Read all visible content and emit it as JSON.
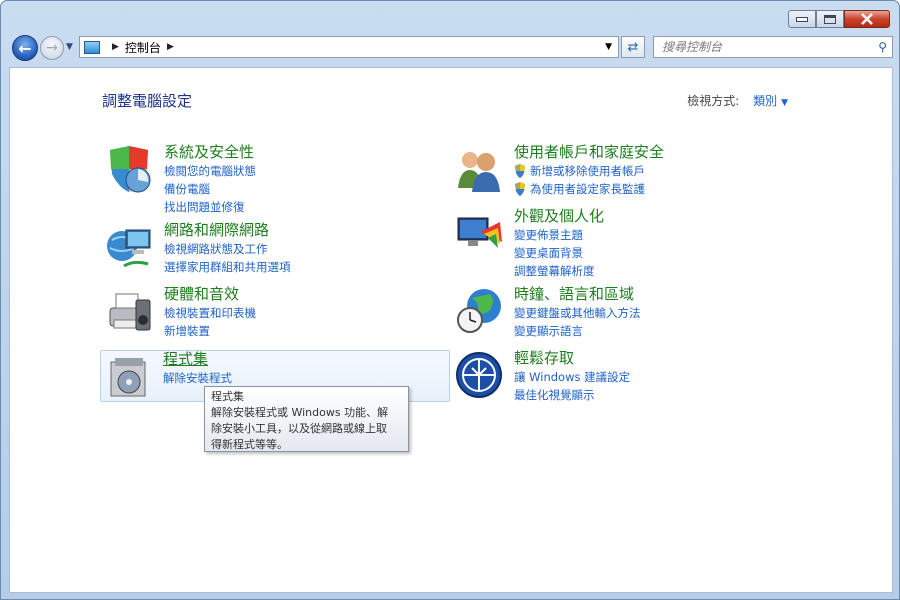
{
  "titlebar": {
    "minimize_icon": "minimize-icon",
    "maximize_icon": "maximize-icon",
    "close_icon": "close-icon"
  },
  "nav": {
    "back_icon": "back-arrow-icon",
    "forward_icon": "forward-arrow-icon",
    "address_path": "控制台",
    "search_placeholder": "搜尋控制台"
  },
  "header": {
    "title": "調整電腦設定",
    "view_by_label": "檢視方式:",
    "view_by_value": "類別"
  },
  "categories": [
    {
      "title": "系統及安全性",
      "links": [
        "檢閱您的電腦狀態",
        "備份電腦",
        "找出問題並修復"
      ]
    },
    {
      "title": "網路和網際網路",
      "links": [
        "檢視網路狀態及工作",
        "選擇家用群組和共用選項"
      ]
    },
    {
      "title": "硬體和音效",
      "links": [
        "檢視裝置和印表機",
        "新增裝置"
      ]
    },
    {
      "title": "程式集",
      "links": [
        "解除安裝程式"
      ]
    },
    {
      "title": "使用者帳戶和家庭安全",
      "links": [
        "新增或移除使用者帳戶",
        "為使用者設定家長監護"
      ]
    },
    {
      "title": "外觀及個人化",
      "links": [
        "變更佈景主題",
        "變更桌面背景",
        "調整螢幕解析度"
      ]
    },
    {
      "title": "時鐘、語言和區域",
      "links": [
        "變更鍵盤或其他輸入方法",
        "變更顯示語言"
      ]
    },
    {
      "title": "輕鬆存取",
      "links": [
        "讓 Windows 建議設定",
        "最佳化視覺顯示"
      ]
    }
  ],
  "tooltip": {
    "title": "程式集",
    "line1": "解除安裝程式或 Windows 功能、解",
    "line2": "除安裝小工具，以及從網路或線上取",
    "line3": "得新程式等等。"
  }
}
